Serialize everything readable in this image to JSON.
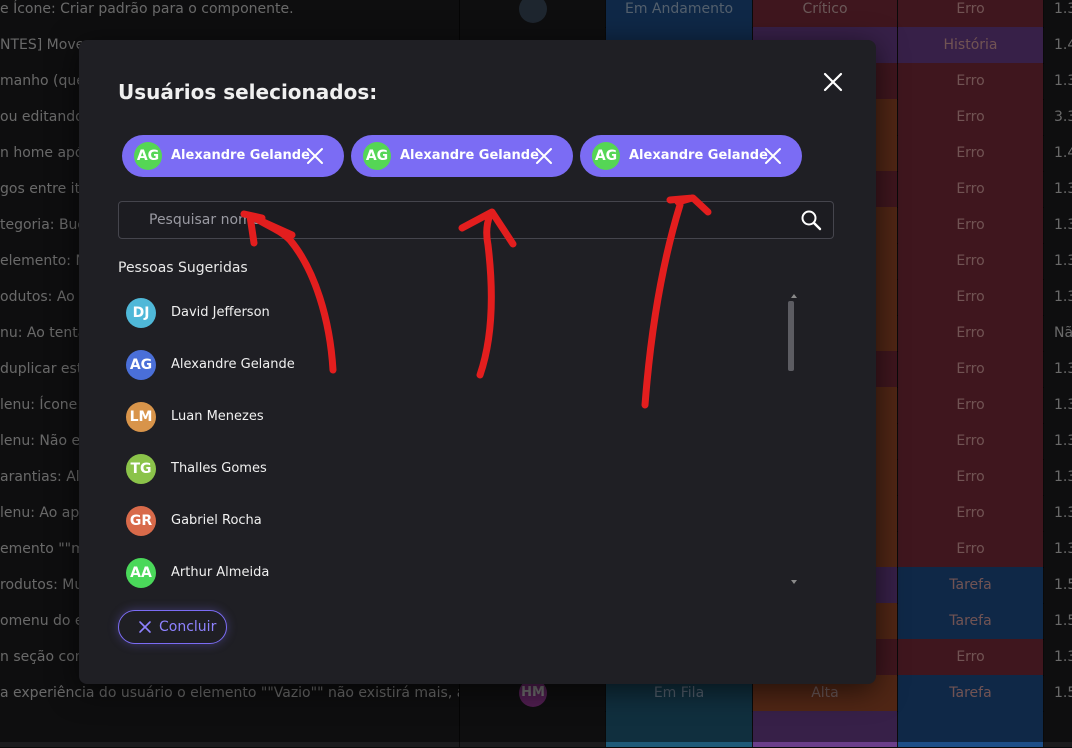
{
  "background_table": {
    "rows": [
      {
        "title": "e Ícone: Criar padrão para o componente.",
        "status": "Em Andamento",
        "priority": "Crítico",
        "type": "Erro",
        "version": "1.3",
        "status_color": "#1d4e88",
        "priority_color": "#7a2b3a",
        "type_color": "#7a2b3a"
      },
      {
        "title": "NTES] Move",
        "status": "",
        "priority": "",
        "type": "História",
        "version": "1.4",
        "status_color": "#1d4e88",
        "priority_color": "#6a3e8a",
        "type_color": "#6a3e8a"
      },
      {
        "title": "manho (que",
        "status": "",
        "priority": "",
        "type": "Erro",
        "version": "1.3",
        "status_color": "#1d4e88",
        "priority_color": "#7a2b3a",
        "type_color": "#7a2b3a"
      },
      {
        "title": "ou editando",
        "status": "",
        "priority": "",
        "type": "Erro",
        "version": "3.3",
        "status_color": "#1d4e88",
        "priority_color": "#9a4a2a",
        "type_color": "#7a2b3a"
      },
      {
        "title": "n home após",
        "status": "",
        "priority": "",
        "type": "Erro",
        "version": "1.4",
        "status_color": "#1d4e88",
        "priority_color": "#9a4a2a",
        "type_color": "#7a2b3a"
      },
      {
        "title": "gos entre ite",
        "status": "",
        "priority": "",
        "type": "Erro",
        "version": "1.3",
        "status_color": "#1d4e88",
        "priority_color": "#7a2b3a",
        "type_color": "#7a2b3a"
      },
      {
        "title": "tegoria: Bug",
        "status": "",
        "priority": "",
        "type": "Erro",
        "version": "1.3",
        "status_color": "#1d4e88",
        "priority_color": "#9a4a2a",
        "type_color": "#7a2b3a"
      },
      {
        "title": "elemento: Nã",
        "status": "",
        "priority": "",
        "type": "Erro",
        "version": "1.3",
        "status_color": "#1d4e88",
        "priority_color": "#9a4a2a",
        "type_color": "#7a2b3a"
      },
      {
        "title": "odutos: Ao e",
        "status": "",
        "priority": "",
        "type": "Erro",
        "version": "1.3",
        "status_color": "#1d4e88",
        "priority_color": "#9a4a2a",
        "type_color": "#7a2b3a"
      },
      {
        "title": "nu: Ao tentar",
        "status": "",
        "priority": "",
        "type": "Erro",
        "version": "Nã",
        "status_color": "#1d4e88",
        "priority_color": "#9a4a2a",
        "type_color": "#7a2b3a"
      },
      {
        "title": "duplicar está",
        "status": "",
        "priority": "",
        "type": "Erro",
        "version": "1.3",
        "status_color": "#1d4e88",
        "priority_color": "#7a2b3a",
        "type_color": "#7a2b3a"
      },
      {
        "title": "lenu: Ícone (",
        "status": "",
        "priority": "",
        "type": "Erro",
        "version": "1.3",
        "status_color": "#1d4e88",
        "priority_color": "#9a4a2a",
        "type_color": "#7a2b3a"
      },
      {
        "title": "lenu: Não es",
        "status": "",
        "priority": "",
        "type": "Erro",
        "version": "1.3",
        "status_color": "#1d4e88",
        "priority_color": "#9a4a2a",
        "type_color": "#7a2b3a"
      },
      {
        "title": "arantias: Ali",
        "status": "",
        "priority": "",
        "type": "Erro",
        "version": "1.3",
        "status_color": "#1d4e88",
        "priority_color": "#9a4a2a",
        "type_color": "#7a2b3a"
      },
      {
        "title": "lenu: Ao apl",
        "status": "",
        "priority": "",
        "type": "Erro",
        "version": "1.3",
        "status_color": "#1d4e88",
        "priority_color": "#9a4a2a",
        "type_color": "#7a2b3a"
      },
      {
        "title": "emento \"\"m",
        "status": "",
        "priority": "",
        "type": "Erro",
        "version": "1.3",
        "status_color": "#1d4e88",
        "priority_color": "#9a4a2a",
        "type_color": "#7a2b3a"
      },
      {
        "title": "rodutos: Mu",
        "status": "",
        "priority": "",
        "type": "Tarefa",
        "version": "1.5",
        "status_color": "#1d4e88",
        "priority_color": "#6a3e8a",
        "type_color": "#1d4e88"
      },
      {
        "title": "omenu do el",
        "status": "",
        "priority": "",
        "type": "Tarefa",
        "version": "1.5",
        "status_color": "#1d4e88",
        "priority_color": "#9a4a2a",
        "type_color": "#1d4e88"
      },
      {
        "title": "n seção com",
        "status": "",
        "priority": "",
        "type": "Erro",
        "version": "1.3",
        "status_color": "#1d4e88",
        "priority_color": "#7a2b3a",
        "type_color": "#7a2b3a"
      },
      {
        "title": "a experiência do usuário o elemento \"\"Vazio\"\" não existirá mais, a...",
        "status": "Em Fila",
        "priority": "Alta",
        "type": "Tarefa",
        "version": "1.5",
        "status_color": "#1f5a78",
        "priority_color": "#9a4a2a",
        "type_color": "#1d4e88"
      },
      {
        "title": "",
        "status": "",
        "priority": "",
        "type": "",
        "version": "",
        "status_color": "#1f5a78",
        "priority_color": "#6a3e8a",
        "type_color": "#1d4e88"
      }
    ],
    "avatars": {
      "row1": "",
      "row_last": "HM"
    }
  },
  "modal": {
    "title": "Usuários selecionados:",
    "selected_users": [
      {
        "initials": "AG",
        "name": "Alexandre Gelande"
      },
      {
        "initials": "AG",
        "name": "Alexandre Gelande"
      },
      {
        "initials": "AG",
        "name": "Alexandre Gelande"
      }
    ],
    "search": {
      "placeholder": "Pesquisar nome"
    },
    "suggested_title": "Pessoas Sugeridas",
    "suggested": [
      {
        "initials": "DJ",
        "name": "David Jefferson",
        "color": "#4fb8d8"
      },
      {
        "initials": "AG",
        "name": "Alexandre Gelande",
        "color": "#4a6fd8"
      },
      {
        "initials": "LM",
        "name": "Luan Menezes",
        "color": "#d8944a"
      },
      {
        "initials": "TG",
        "name": "Thalles Gomes",
        "color": "#8bc34a"
      },
      {
        "initials": "GR",
        "name": "Gabriel Rocha",
        "color": "#d86a4a"
      },
      {
        "initials": "AA",
        "name": "Arthur Almeida",
        "color": "#4ad85a"
      }
    ],
    "done_label": "Concluir"
  },
  "colors": {
    "accent": "#7b6cf4",
    "chip_avatar": "#55d655",
    "annotation": "#e31e1e"
  }
}
